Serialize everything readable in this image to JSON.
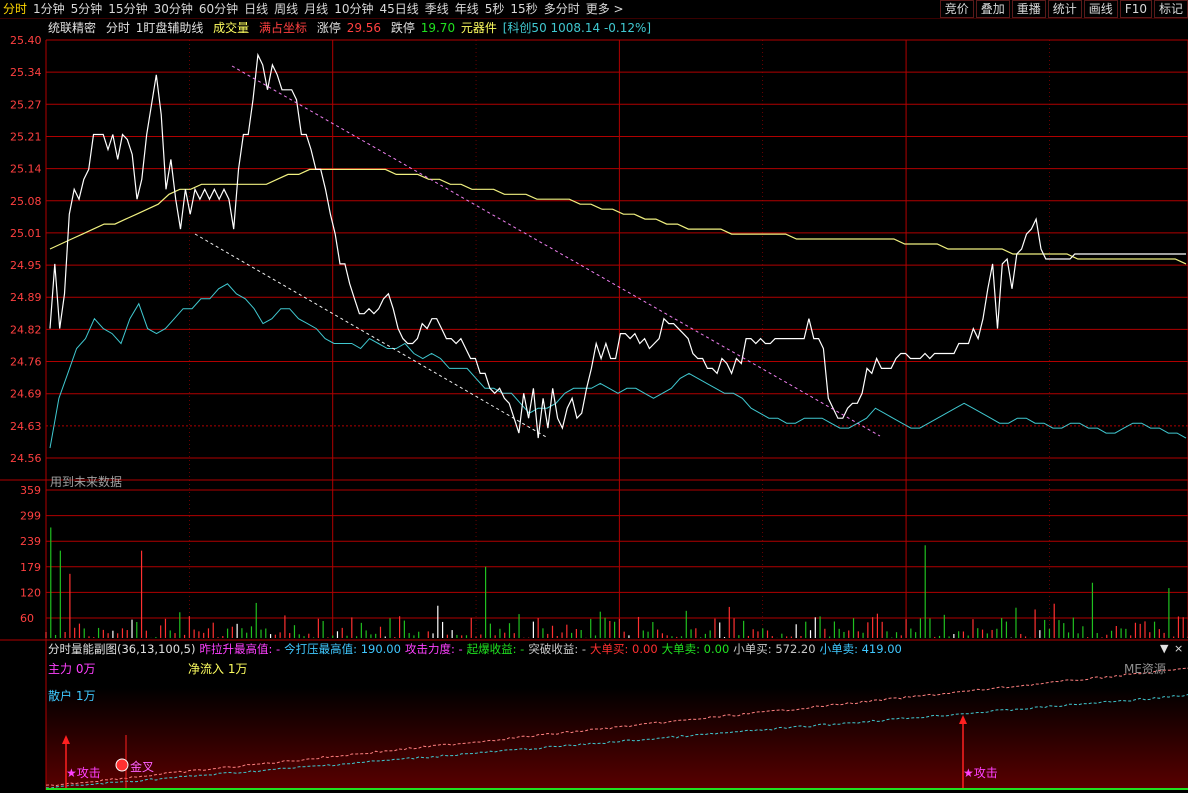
{
  "toolbar": {
    "tabs": [
      "分时",
      "1分钟",
      "5分钟",
      "15分钟",
      "30分钟",
      "60分钟",
      "日线",
      "周线",
      "月线",
      "10分钟",
      "45日线",
      "季线",
      "年线",
      "5秒",
      "15秒",
      "多分时",
      "更多 >"
    ],
    "active_tab": 0,
    "right_buttons": [
      "竞价",
      "叠加",
      "重播",
      "统计",
      "画线",
      "F10",
      "标记"
    ]
  },
  "info": {
    "stock_name": "统联精密",
    "period": "分时",
    "indicator": "1盯盘辅助线",
    "volume_label": "成交量",
    "coord_label": "满占坐标",
    "limit_up_label": "涨停",
    "limit_up_value": "29.56",
    "limit_down_label": "跌停",
    "limit_down_value": "19.70",
    "sector": "元器件",
    "index_info": "[科创50 1008.14 -0.12%]",
    "future_data_note": "用到未来数据"
  },
  "colors": {
    "grid_red": "#b00000",
    "price_line": "#ffffff",
    "avg_line": "#f0f080",
    "cyan_line": "#40c8d0",
    "up_bar": "#ff3030",
    "down_bar": "#20c020",
    "flat_bar": "#ffffff",
    "magenta": "#ff40ff",
    "yellow": "#ffff60",
    "axis_label": "#ff4040"
  },
  "price_axis": [
    "25.40",
    "25.34",
    "25.27",
    "25.21",
    "25.14",
    "25.08",
    "25.01",
    "24.95",
    "24.89",
    "24.82",
    "24.76",
    "24.69",
    "24.63",
    "24.56"
  ],
  "volume_axis": [
    "359",
    "299",
    "239",
    "179",
    "120",
    "60"
  ],
  "sub_indicator": {
    "title": "分时量能副图(36,13,100,5)",
    "items": [
      {
        "label": "昨拉升最高值:",
        "value": "-",
        "color": "#ff40ff"
      },
      {
        "label": "今打压最高值:",
        "value": "190.00",
        "color": "#40c8ff"
      },
      {
        "label": "攻击力度:",
        "value": "-",
        "color": "#ff40ff"
      },
      {
        "label": "起爆收益:",
        "value": "-",
        "color": "#20e020"
      },
      {
        "label": "突破收益:",
        "value": "-",
        "color": "#c8c8c8"
      },
      {
        "label": "大单买:",
        "value": "0.00",
        "color": "#ff3030"
      },
      {
        "label": "大单卖:",
        "value": "0.00",
        "color": "#20e020"
      },
      {
        "label": "小单买:",
        "value": "572.20",
        "color": "#c8c8c8"
      },
      {
        "label": "小单卖:",
        "value": "419.00",
        "color": "#40c8ff"
      }
    ],
    "main_force": "主力 0万",
    "net_inflow": "净流入 1万",
    "retail": "散户 1万",
    "watermark": "ME资源",
    "attack_label_1": "★攻击",
    "golden_cross": "金叉",
    "attack_label_2": "★攻击"
  },
  "chart_data": {
    "type": "line",
    "title": "",
    "x_count": 240,
    "ylim": [
      24.56,
      25.4
    ],
    "price_series": [
      24.82,
      24.95,
      24.82,
      24.89,
      25.05,
      25.1,
      25.08,
      25.12,
      25.14,
      25.21,
      25.21,
      25.21,
      25.18,
      25.21,
      25.16,
      25.21,
      25.2,
      25.17,
      25.08,
      25.12,
      25.21,
      25.27,
      25.33,
      25.25,
      25.1,
      25.16,
      25.08,
      25.02,
      25.1,
      25.05,
      25.1,
      25.08,
      25.1,
      25.08,
      25.1,
      25.08,
      25.1,
      25.08,
      25.02,
      25.14,
      25.21,
      25.21,
      25.28,
      25.37,
      25.35,
      25.3,
      25.35,
      25.33,
      25.3,
      25.3,
      25.3,
      25.28,
      25.21,
      25.21,
      25.18,
      25.14,
      25.14,
      25.1,
      25.05,
      25.01,
      24.95,
      24.95,
      24.91,
      24.88,
      24.85,
      24.85,
      24.86,
      24.85,
      24.86,
      24.88,
      24.89,
      24.86,
      24.82,
      24.8,
      24.79,
      24.79,
      24.8,
      24.83,
      24.82,
      24.84,
      24.84,
      24.82,
      24.8,
      24.8,
      24.79,
      24.8,
      24.78,
      24.76,
      24.76,
      24.73,
      24.73,
      24.7,
      24.69,
      24.7,
      24.68,
      24.67,
      24.64,
      24.61,
      24.69,
      24.64,
      24.7,
      24.6,
      24.68,
      24.62,
      24.7,
      24.64,
      24.62,
      24.66,
      24.68,
      24.64,
      24.65,
      24.7,
      24.74,
      24.79,
      24.76,
      24.79,
      24.76,
      24.76,
      24.81,
      24.81,
      24.8,
      24.81,
      24.79,
      24.8,
      24.78,
      24.79,
      24.8,
      24.84,
      24.83,
      24.83,
      24.82,
      24.81,
      24.8,
      24.77,
      24.76,
      24.76,
      24.74,
      24.74,
      24.73,
      24.76,
      24.75,
      24.73,
      24.76,
      24.75,
      24.8,
      24.8,
      24.79,
      24.8,
      24.79,
      24.79,
      24.8,
      24.8,
      24.8,
      24.8,
      24.8,
      24.8,
      24.8,
      24.84,
      24.8,
      24.8,
      24.78,
      24.68,
      24.66,
      24.64,
      24.64,
      24.66,
      24.67,
      24.67,
      24.69,
      24.74,
      24.73,
      24.76,
      24.74,
      24.74,
      24.74,
      24.76,
      24.77,
      24.77,
      24.76,
      24.76,
      24.76,
      24.77,
      24.76,
      24.77,
      24.77,
      24.77,
      24.77,
      24.77,
      24.79,
      24.79,
      24.79,
      24.82,
      24.8,
      24.84,
      24.9,
      24.95,
      24.82,
      24.95,
      24.96,
      24.9,
      24.97,
      24.98,
      25.01,
      25.02,
      25.04,
      24.98,
      24.96,
      24.96,
      24.96,
      24.96,
      24.96,
      24.96,
      24.97,
      24.97,
      24.97,
      24.97,
      24.97,
      24.97,
      24.97,
      24.97,
      24.97,
      24.97,
      24.97,
      24.97,
      24.97,
      24.97,
      24.97,
      24.97,
      24.97,
      24.97,
      24.97,
      24.97,
      24.97,
      24.97,
      24.97,
      24.97
    ],
    "average_series": [
      24.98,
      24.99,
      25.0,
      25.01,
      25.02,
      25.03,
      25.03,
      25.04,
      25.05,
      25.06,
      25.07,
      25.09,
      25.1,
      25.1,
      25.11,
      25.11,
      25.11,
      25.11,
      25.11,
      25.11,
      25.11,
      25.12,
      25.13,
      25.13,
      25.14,
      25.14,
      25.14,
      25.14,
      25.14,
      25.14,
      25.14,
      25.14,
      25.13,
      25.13,
      25.13,
      25.12,
      25.12,
      25.11,
      25.11,
      25.1,
      25.1,
      25.1,
      25.09,
      25.09,
      25.09,
      25.08,
      25.08,
      25.08,
      25.08,
      25.07,
      25.07,
      25.06,
      25.06,
      25.05,
      25.05,
      25.04,
      25.04,
      25.03,
      25.03,
      25.02,
      25.02,
      25.02,
      25.02,
      25.01,
      25.01,
      25.01,
      25.01,
      25.01,
      25.01,
      25.0,
      25.0,
      25.0,
      25.0,
      25.0,
      25.0,
      25.0,
      25.0,
      25.0,
      25.0,
      24.99,
      24.99,
      24.99,
      24.99,
      24.98,
      24.98,
      24.98,
      24.98,
      24.98,
      24.98,
      24.97,
      24.97,
      24.97,
      24.97,
      24.97,
      24.97,
      24.96,
      24.96,
      24.96,
      24.96,
      24.96,
      24.96,
      24.96,
      24.96,
      24.96,
      24.96,
      24.95
    ],
    "cyan_series": [
      24.58,
      24.68,
      24.73,
      24.78,
      24.8,
      24.84,
      24.82,
      24.81,
      24.79,
      24.84,
      24.87,
      24.82,
      24.81,
      24.82,
      24.84,
      24.86,
      24.86,
      24.88,
      24.88,
      24.9,
      24.91,
      24.89,
      24.88,
      24.86,
      24.83,
      24.84,
      24.86,
      24.86,
      24.84,
      24.83,
      24.82,
      24.8,
      24.79,
      24.79,
      24.79,
      24.78,
      24.8,
      24.79,
      24.78,
      24.78,
      24.79,
      24.77,
      24.76,
      24.77,
      24.76,
      24.74,
      24.74,
      24.74,
      24.72,
      24.7,
      24.7,
      24.69,
      24.69,
      24.67,
      24.65,
      24.66,
      24.66,
      24.67,
      24.69,
      24.7,
      24.7,
      24.7,
      24.71,
      24.7,
      24.69,
      24.7,
      24.7,
      24.69,
      24.68,
      24.69,
      24.7,
      24.72,
      24.73,
      24.72,
      24.71,
      24.7,
      24.69,
      24.69,
      24.68,
      24.66,
      24.65,
      24.64,
      24.64,
      24.63,
      24.63,
      24.64,
      24.64,
      24.64,
      24.63,
      24.62,
      24.62,
      24.63,
      24.64,
      24.66,
      24.65,
      24.64,
      24.63,
      24.62,
      24.62,
      24.63,
      24.64,
      24.65,
      24.66,
      24.67,
      24.66,
      24.65,
      24.64,
      24.63,
      24.63,
      24.64,
      24.64,
      24.63,
      24.63,
      24.62,
      24.62,
      24.63,
      24.63,
      24.62,
      24.62,
      24.61,
      24.61,
      24.62,
      24.63,
      24.63,
      24.62,
      24.62,
      24.61,
      24.61,
      24.6
    ]
  }
}
